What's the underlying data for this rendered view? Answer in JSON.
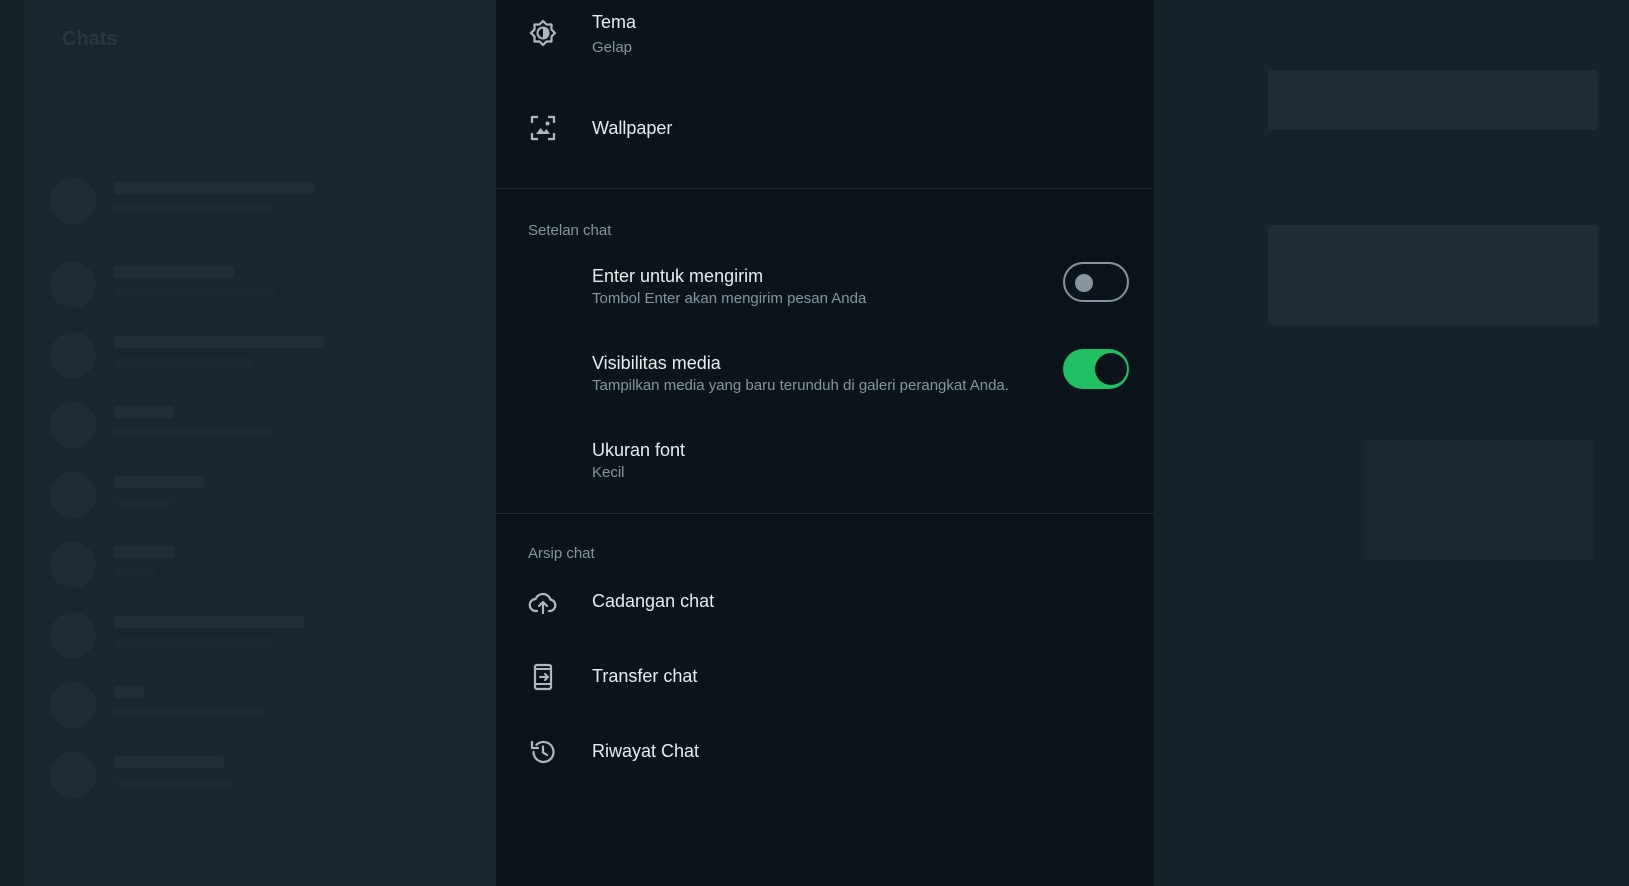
{
  "background": {
    "left_title": "Chats"
  },
  "settings": {
    "theme": {
      "title": "Tema",
      "subtitle": "Gelap",
      "icon": "theme-icon"
    },
    "wallpaper": {
      "title": "Wallpaper",
      "icon": "wallpaper-icon"
    },
    "chat_settings": {
      "header": "Setelan chat",
      "enter_to_send": {
        "title": "Enter untuk mengirim",
        "subtitle": "Tombol Enter akan mengirim pesan Anda",
        "enabled": false
      },
      "media_visibility": {
        "title": "Visibilitas media",
        "subtitle": "Tampilkan media yang baru terunduh di galeri perangkat Anda.",
        "enabled": true
      },
      "font_size": {
        "title": "Ukuran font",
        "subtitle": "Kecil"
      }
    },
    "chat_archive": {
      "header": "Arsip chat",
      "backup": {
        "title": "Cadangan chat",
        "icon": "cloud-upload-icon"
      },
      "transfer": {
        "title": "Transfer chat",
        "icon": "phone-transfer-icon"
      },
      "history": {
        "title": "Riwayat Chat",
        "icon": "history-icon"
      }
    }
  },
  "colors": {
    "accent": "#21c063",
    "panel_bg": "#0b141a",
    "text_primary": "#e9edef",
    "text_secondary": "#8696a0"
  }
}
